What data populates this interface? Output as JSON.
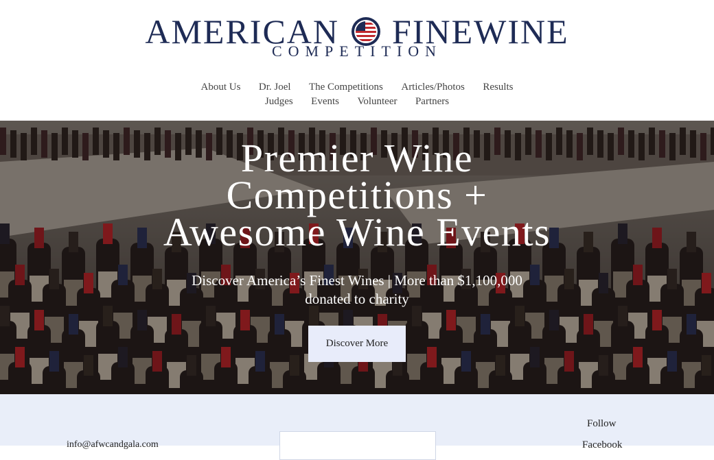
{
  "logo": {
    "word1": "AMERICAN",
    "word2": "FINEWINE",
    "subtitle": "COMPETITION"
  },
  "nav": {
    "row1": [
      "About Us",
      "Dr. Joel",
      "The Competitions",
      "Articles/Photos",
      "Results"
    ],
    "row2": [
      "Judges",
      "Events",
      "Volunteer",
      "Partners"
    ]
  },
  "hero": {
    "title_line1": "Premier Wine",
    "title_line2": "Competitions +",
    "title_line3": "Awesome Wine Events",
    "subtitle": "Discover America’s Finest Wines | More than $1,100,000 donated to charity",
    "button_label": "Discover More"
  },
  "footer": {
    "email": "info@afwcandgala.com",
    "follow_label": "Follow",
    "facebook_label": "Facebook"
  },
  "colors": {
    "brand_navy": "#1e2b55",
    "footer_bg": "#e9eef9",
    "button_bg": "#e8ecfa"
  }
}
